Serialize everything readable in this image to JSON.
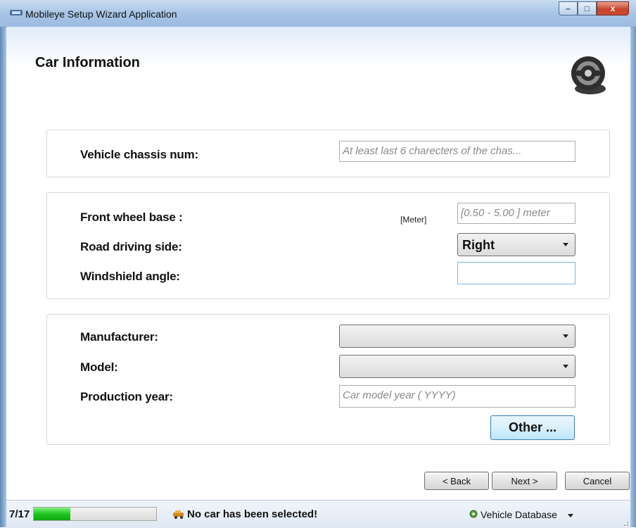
{
  "window": {
    "title": "Mobileye Setup Wizard Application",
    "minimize": "–",
    "maximize": "□",
    "close": "x"
  },
  "page": {
    "title": "Car Information"
  },
  "chassis": {
    "label": "Vehicle chassis num:",
    "placeholder": "At least last 6 charecters of the chas..."
  },
  "car_params": {
    "wheel_base_label": "Front wheel base :",
    "wheel_base_unit": "[Meter]",
    "wheel_base_placeholder": "[0.50 - 5.00 ] meter",
    "driving_side_label": "Road driving side:",
    "driving_side_value": "Right",
    "windshield_label": "Windshield angle:",
    "windshield_value": ""
  },
  "vehicle": {
    "manufacturer_label": "Manufacturer:",
    "manufacturer_value": "",
    "model_label": "Model:",
    "model_value": "",
    "year_label": "Production year:",
    "year_placeholder": "Car model year ( YYYY)",
    "other_button": "Other ..."
  },
  "nav": {
    "back": "< Back",
    "next": "Next >",
    "cancel": "Cancel"
  },
  "status": {
    "step": "7/17",
    "progress": 0.3,
    "message": "No car has been selected!",
    "database": "Vehicle Database"
  },
  "colors": {
    "progress": "#1fc51f",
    "accent": "#3c7fb1"
  }
}
